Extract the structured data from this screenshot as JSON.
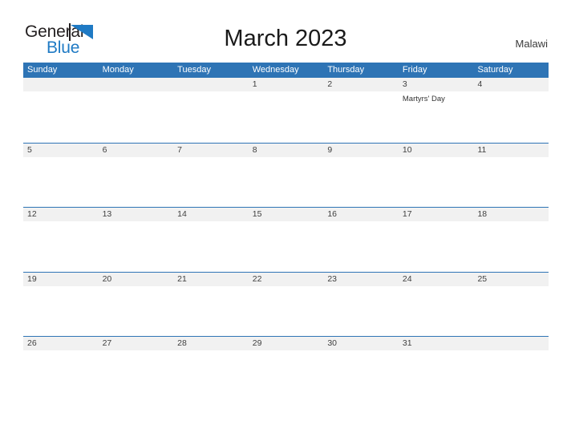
{
  "brand": {
    "name_part1": "General",
    "name_part2": "Blue",
    "flag_icon": "blue-flag-triangle",
    "colors": {
      "text_dark": "#231f20",
      "text_blue": "#1f7ac4"
    }
  },
  "header": {
    "title": "March 2023",
    "locale": "Malawi"
  },
  "calendar": {
    "accent_color": "#2e74b5",
    "band_color": "#f1f1f1",
    "weekdays": [
      "Sunday",
      "Monday",
      "Tuesday",
      "Wednesday",
      "Thursday",
      "Friday",
      "Saturday"
    ],
    "weeks": [
      {
        "days": [
          {
            "num": "",
            "event": ""
          },
          {
            "num": "",
            "event": ""
          },
          {
            "num": "",
            "event": ""
          },
          {
            "num": "1",
            "event": ""
          },
          {
            "num": "2",
            "event": ""
          },
          {
            "num": "3",
            "event": "Martyrs' Day"
          },
          {
            "num": "4",
            "event": ""
          }
        ]
      },
      {
        "days": [
          {
            "num": "5",
            "event": ""
          },
          {
            "num": "6",
            "event": ""
          },
          {
            "num": "7",
            "event": ""
          },
          {
            "num": "8",
            "event": ""
          },
          {
            "num": "9",
            "event": ""
          },
          {
            "num": "10",
            "event": ""
          },
          {
            "num": "11",
            "event": ""
          }
        ]
      },
      {
        "days": [
          {
            "num": "12",
            "event": ""
          },
          {
            "num": "13",
            "event": ""
          },
          {
            "num": "14",
            "event": ""
          },
          {
            "num": "15",
            "event": ""
          },
          {
            "num": "16",
            "event": ""
          },
          {
            "num": "17",
            "event": ""
          },
          {
            "num": "18",
            "event": ""
          }
        ]
      },
      {
        "days": [
          {
            "num": "19",
            "event": ""
          },
          {
            "num": "20",
            "event": ""
          },
          {
            "num": "21",
            "event": ""
          },
          {
            "num": "22",
            "event": ""
          },
          {
            "num": "23",
            "event": ""
          },
          {
            "num": "24",
            "event": ""
          },
          {
            "num": "25",
            "event": ""
          }
        ]
      },
      {
        "days": [
          {
            "num": "26",
            "event": ""
          },
          {
            "num": "27",
            "event": ""
          },
          {
            "num": "28",
            "event": ""
          },
          {
            "num": "29",
            "event": ""
          },
          {
            "num": "30",
            "event": ""
          },
          {
            "num": "31",
            "event": ""
          },
          {
            "num": "",
            "event": ""
          }
        ]
      }
    ]
  }
}
